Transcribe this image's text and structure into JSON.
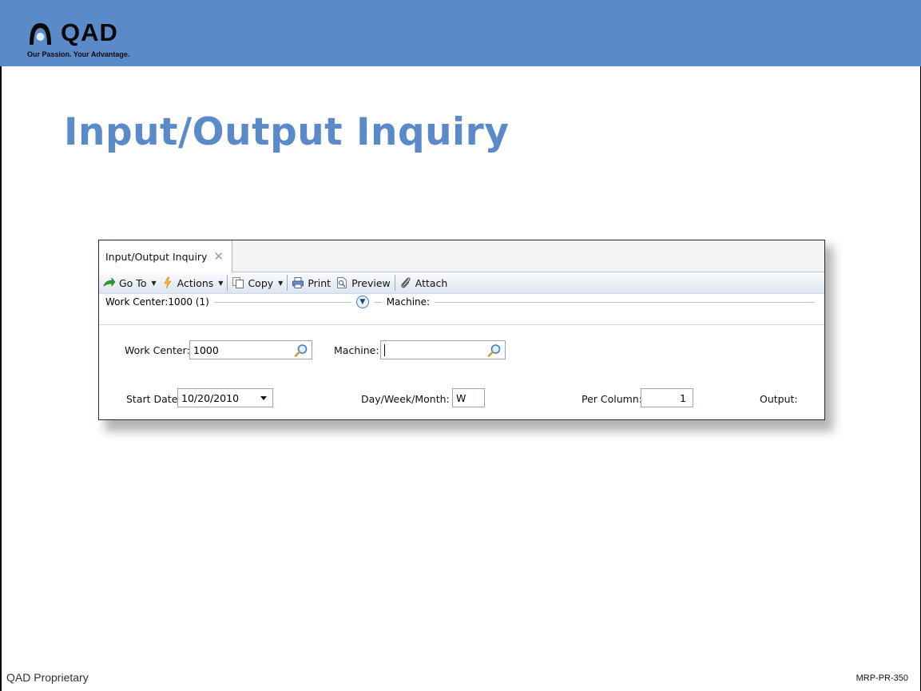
{
  "brand": {
    "logo_text": "QAD",
    "tagline": "Our Passion. Your Advantage.",
    "band_color": "#5b8ac8"
  },
  "slide": {
    "title": "Input/Output Inquiry",
    "title_color": "#5b8ac8",
    "footer_left": "QAD Proprietary",
    "footer_right": "MRP-PR-350"
  },
  "window": {
    "tab_label": "Input/Output Inquiry",
    "tab_close_icon": "close-icon",
    "toolbar": {
      "goto_label": "Go To",
      "actions_label": "Actions",
      "copy_label": "Copy",
      "print_label": "Print",
      "preview_label": "Preview",
      "attach_label": "Attach"
    },
    "section_header": {
      "work_center": "Work Center:1000 (1)",
      "machine": "Machine:"
    },
    "form": {
      "work_center_label": "Work Center:",
      "work_center_value": "1000",
      "machine_label": "Machine:",
      "machine_value": "",
      "start_date_label": "Start Date:",
      "start_date_value": "10/20/2010",
      "period_label": "Day/Week/Month:",
      "period_value": "W",
      "per_column_label": "Per Column:",
      "per_column_value": "1",
      "output_label": "Output:"
    }
  }
}
